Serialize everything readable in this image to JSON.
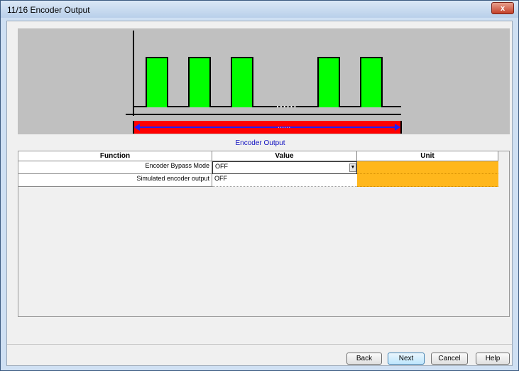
{
  "window": {
    "title": "11/16 Encoder Output",
    "close_label": "x"
  },
  "diagram": {
    "dots": "......",
    "bar_dots": "......",
    "caption": "Encoder Output"
  },
  "grid": {
    "columns": [
      "Function",
      "Value",
      "Unit"
    ],
    "rows": [
      {
        "function": "Encoder Bypass Mode",
        "value": "OFF",
        "unit": "",
        "has_dropdown": true
      },
      {
        "function": "Simulated encoder output",
        "value": "OFF",
        "unit": ""
      }
    ]
  },
  "buttons": {
    "back": "Back",
    "next": "Next",
    "cancel": "Cancel",
    "help": "Help"
  },
  "colors": {
    "pulse": "#00ff00",
    "bar": "#ff0000",
    "arrow": "#2020ff",
    "unit_cell": "#ffb71c"
  }
}
